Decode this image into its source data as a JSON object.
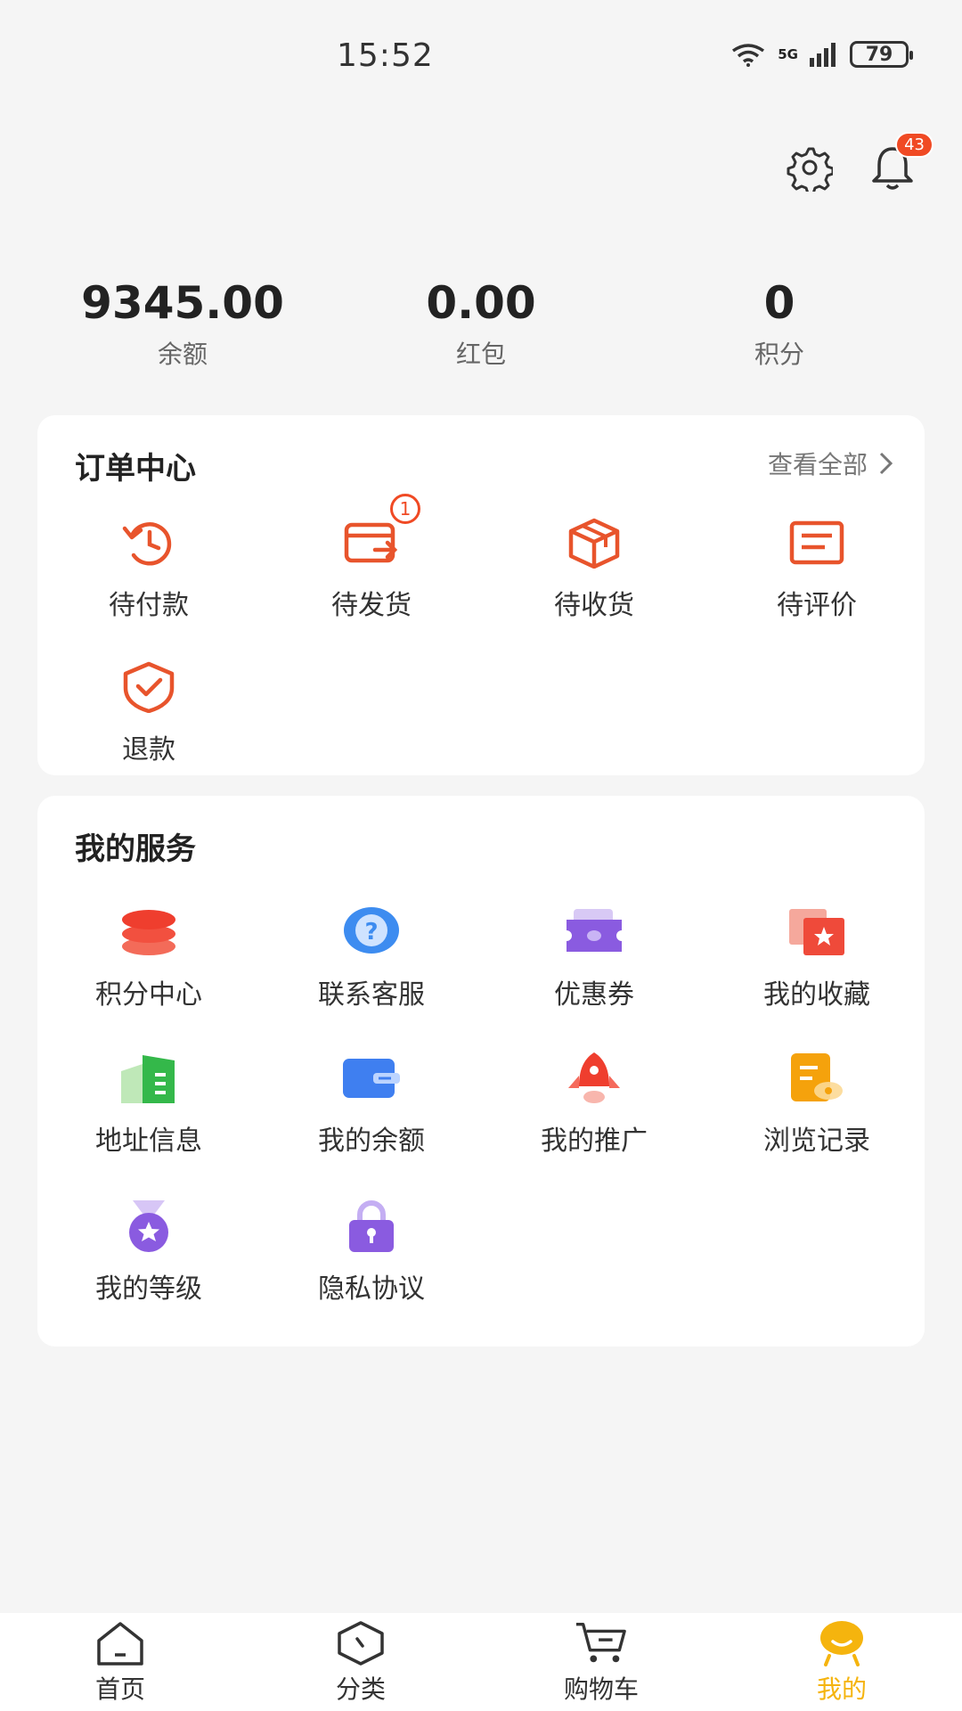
{
  "status_bar": {
    "time": "15:52",
    "network": "5G",
    "battery": "79"
  },
  "header": {
    "notification_count": "43"
  },
  "stats": [
    {
      "value": "9345.00",
      "label": "余额"
    },
    {
      "value": "0.00",
      "label": "红包"
    },
    {
      "value": "0",
      "label": "积分"
    }
  ],
  "orders": {
    "title": "订单中心",
    "view_all": "查看全部",
    "items": [
      {
        "label": "待付款"
      },
      {
        "label": "待发货",
        "badge": "1"
      },
      {
        "label": "待收货"
      },
      {
        "label": "待评价"
      },
      {
        "label": "退款"
      }
    ]
  },
  "services": {
    "title": "我的服务",
    "items": [
      {
        "label": "积分中心"
      },
      {
        "label": "联系客服"
      },
      {
        "label": "优惠券"
      },
      {
        "label": "我的收藏"
      },
      {
        "label": "地址信息"
      },
      {
        "label": "我的余额"
      },
      {
        "label": "我的推广"
      },
      {
        "label": "浏览记录"
      },
      {
        "label": "我的等级"
      },
      {
        "label": "隐私协议"
      }
    ]
  },
  "bottom_nav": [
    {
      "label": "首页"
    },
    {
      "label": "分类"
    },
    {
      "label": "购物车"
    },
    {
      "label": "我的"
    }
  ],
  "colors": {
    "accent_orange": "#f04a24",
    "active_nav": "#f5b40e"
  }
}
